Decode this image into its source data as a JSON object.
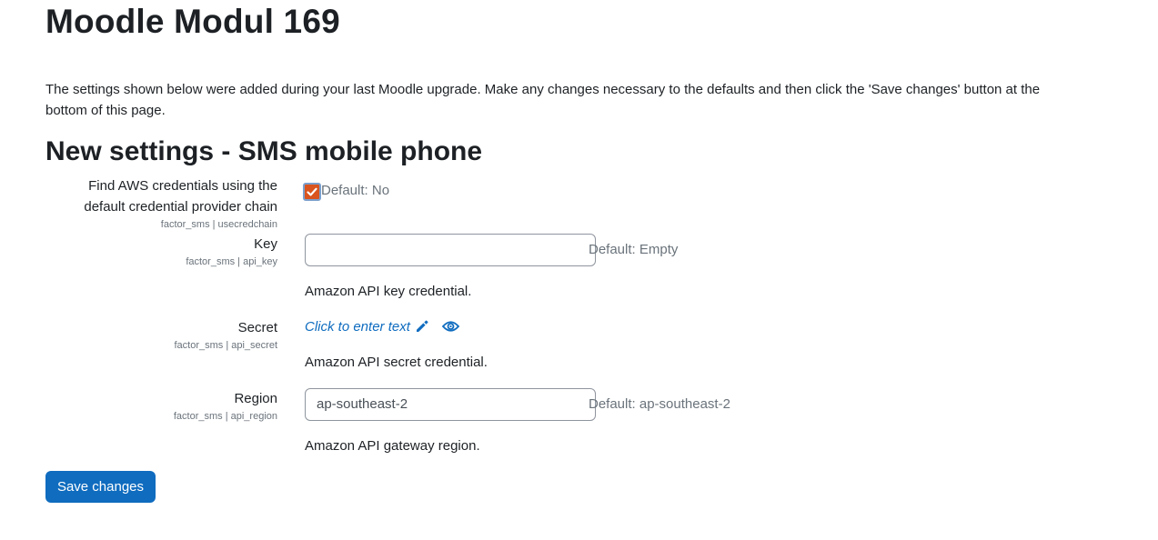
{
  "page": {
    "title": "Moodle Modul 169",
    "intro": "The settings shown below were added during your last Moodle upgrade. Make any changes necessary to the defaults and then click the 'Save changes' button at the bottom of this page.",
    "section_title": "New settings - SMS mobile phone"
  },
  "settings": {
    "usecredchain": {
      "label_line1": "Find AWS credentials using the",
      "label_line2": "default credential provider chain",
      "ident": "factor_sms | usecredchain",
      "checked": true,
      "default": "Default: No"
    },
    "api_key": {
      "label": "Key",
      "ident": "factor_sms | api_key",
      "value": "",
      "default": "Default: Empty",
      "description": "Amazon API key credential."
    },
    "api_secret": {
      "label": "Secret",
      "ident": "factor_sms | api_secret",
      "placeholder": "Click to enter text",
      "edit_icon": "pencil-icon",
      "reveal_icon": "eye-icon",
      "description": "Amazon API secret credential."
    },
    "api_region": {
      "label": "Region",
      "ident": "factor_sms | api_region",
      "value": "ap-southeast-2",
      "default": "Default: ap-southeast-2",
      "description": "Amazon API gateway region."
    }
  },
  "actions": {
    "save_label": "Save changes"
  },
  "colors": {
    "primary": "#0f6cbf",
    "checkbox_checked": "#d9541e",
    "muted_text": "#6a737b"
  }
}
